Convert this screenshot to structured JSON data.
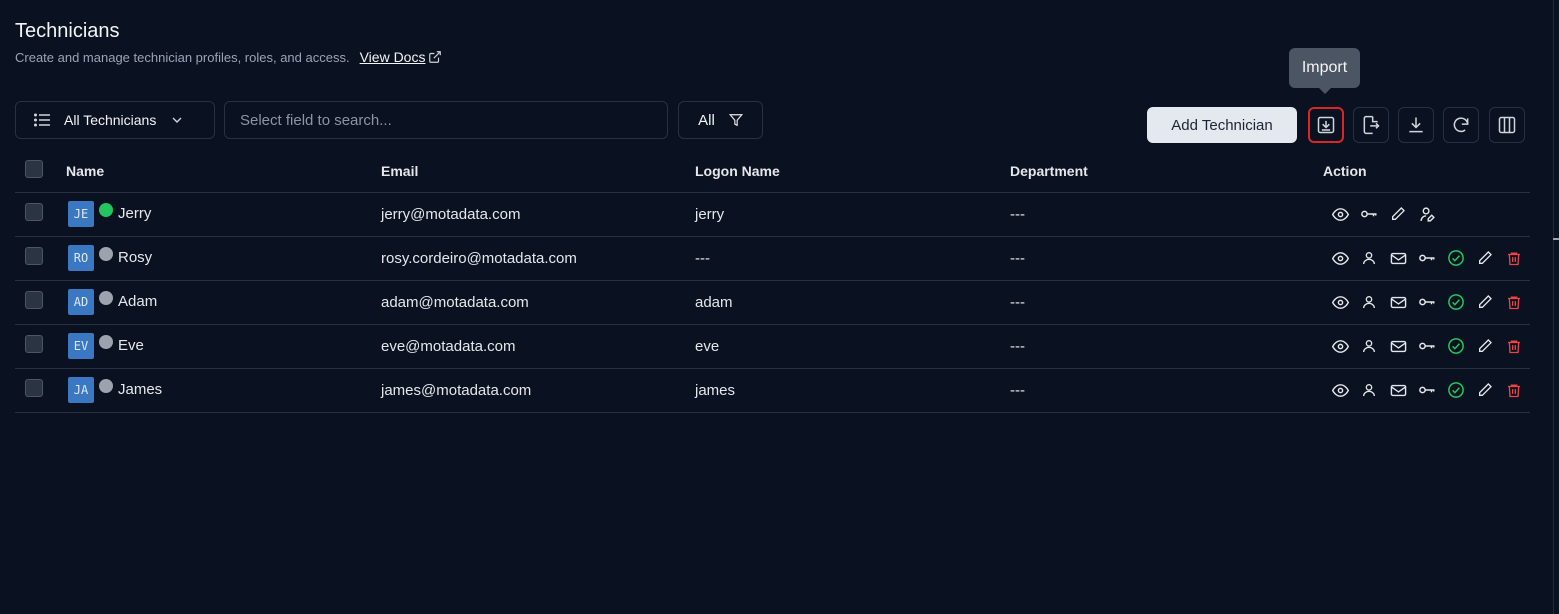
{
  "header": {
    "title": "Technicians",
    "subtitle": "Create and manage technician profiles, roles, and access.",
    "docs_link": "View Docs"
  },
  "toolbar": {
    "filter_label": "All Technicians",
    "search_placeholder": "Select field to search...",
    "all_filter_label": "All",
    "add_button": "Add Technician",
    "tooltip": "Import"
  },
  "table": {
    "columns": [
      "Name",
      "Email",
      "Logon Name",
      "Department",
      "Action"
    ],
    "rows": [
      {
        "initials": "JE",
        "name": "Jerry",
        "online": true,
        "email": "jerry@motadata.com",
        "logon": "jerry",
        "department": "---"
      },
      {
        "initials": "RO",
        "name": "Rosy",
        "online": false,
        "email": "rosy.cordeiro@motadata.com",
        "logon": "---",
        "department": "---"
      },
      {
        "initials": "AD",
        "name": "Adam",
        "online": false,
        "email": "adam@motadata.com",
        "logon": "adam",
        "department": "---"
      },
      {
        "initials": "EV",
        "name": "Eve",
        "online": false,
        "email": "eve@motadata.com",
        "logon": "eve",
        "department": "---"
      },
      {
        "initials": "JA",
        "name": "James",
        "online": false,
        "email": "james@motadata.com",
        "logon": "james",
        "department": "---"
      }
    ]
  },
  "colors": {
    "background": "#0a1120",
    "online": "#22c55e",
    "offline": "#9ca3af",
    "check": "#22c55e",
    "delete": "#ef4444",
    "avatar": "#3a78c2"
  }
}
